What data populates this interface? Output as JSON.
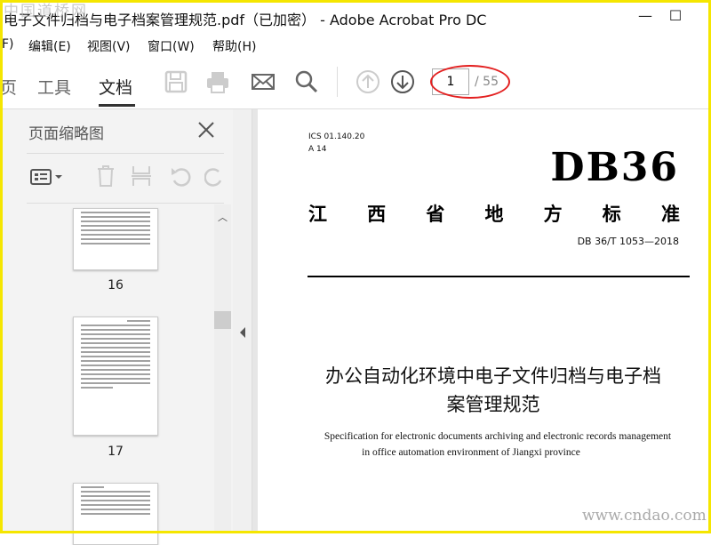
{
  "watermark_top": "中国道桥网",
  "watermark_bottom": "www.cndao.com",
  "window": {
    "title": "电子文件归档与电子档案管理规范.pdf（已加密） - Adobe Acrobat Pro DC",
    "minimize": "—",
    "maximize": "☐"
  },
  "menu": [
    "F)",
    "编辑(E)",
    "视图(V)",
    "窗口(W)",
    "帮助(H)"
  ],
  "tabs": {
    "home": "页",
    "tools": "工具",
    "document": "文档"
  },
  "page_nav": {
    "current": "1",
    "total": "/ 55"
  },
  "thumbnails": {
    "title": "页面缩略图",
    "pages": [
      "16",
      "17"
    ]
  },
  "document": {
    "ics": "ICS 01.140.20",
    "class": "A 14",
    "code": "DB36",
    "standard_type": [
      "江",
      "西",
      "省",
      "地",
      "方",
      "标",
      "准"
    ],
    "number": "DB 36/T 1053—2018",
    "title_cn_1": "办公自动化环境中电子文件归档与电子档",
    "title_cn_2": "案管理规范",
    "title_en_1": "Specification for electronic documents archiving and electronic records management",
    "title_en_2": "in office automation environment of Jiangxi province"
  },
  "colors": {
    "highlight_circle": "#e32020",
    "frame": "#f5e600"
  }
}
